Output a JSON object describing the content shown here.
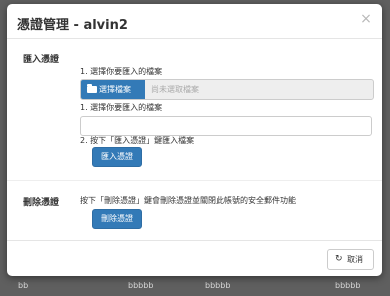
{
  "backdrop": {
    "bottom_row": [
      "bb",
      "bbbbb",
      "bbbbb",
      "bbbbb"
    ]
  },
  "dialog": {
    "title": "憑證管理 - alvin2",
    "close_glyph": "×"
  },
  "import_section": {
    "title": "匯入憑證",
    "step1_file_label": "1. 選擇你要匯入的檔案",
    "choose_file_label": "選擇檔案",
    "file_status": "尚未選取檔案",
    "step1_text_label": "1. 選擇你要匯入的檔案",
    "text_input_value": "",
    "step2_label": "2. 按下「匯入憑證」鍵匯入檔案",
    "import_button": "匯入憑證"
  },
  "delete_section": {
    "title": "刪除憑證",
    "description": "按下「刪除憑證」鍵會刪除憑證並關閉此帳號的安全郵件功能",
    "delete_button": "刪除憑證"
  },
  "footer": {
    "cancel_icon": "↻",
    "cancel_label": "取消"
  },
  "colors": {
    "primary": "#337ab7",
    "backdrop": "#5f5f5f"
  }
}
